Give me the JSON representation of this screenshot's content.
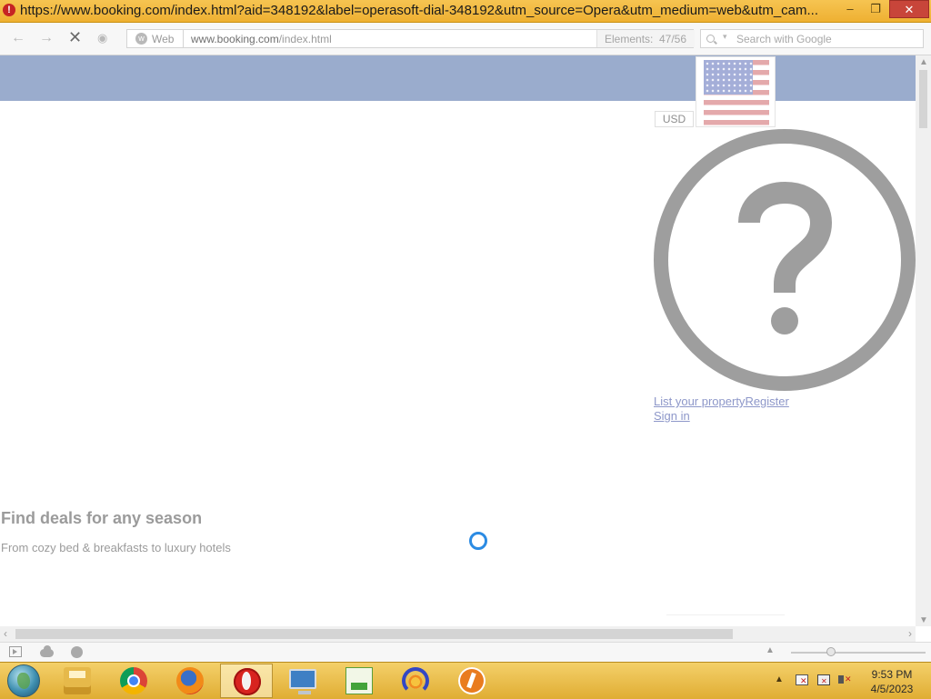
{
  "window": {
    "title": "https://www.booking.com/index.html?aid=348192&label=operasoft-dial-348192&utm_source=Opera&utm_medium=web&utm_cam...",
    "controls": {
      "minimize": "–",
      "maximize": "❐",
      "close": "✕"
    }
  },
  "navbar": {
    "search_type": "Web",
    "url_host": "www.booking.com",
    "url_path": "/index.html",
    "elements_label": "Elements:",
    "elements_count": "47/56",
    "search_placeholder": "Search with Google"
  },
  "page": {
    "currency": "USD",
    "flag_country": "United States",
    "links": {
      "list_property": "List your property",
      "register": "Register",
      "sign_in": "Sign in"
    },
    "deals_title": "Find deals for any season",
    "deals_subtitle": "From cozy bed & breakfasts to luxury hotels"
  },
  "statusbar": {
    "zoom_fraction": 0.3
  },
  "taskbar": {
    "apps": [
      {
        "name": "File Explorer",
        "icon": "file-explorer-icon",
        "active": false
      },
      {
        "name": "Google Chrome",
        "icon": "chrome-icon",
        "active": false
      },
      {
        "name": "Firefox",
        "icon": "firefox-icon",
        "active": false
      },
      {
        "name": "Opera",
        "icon": "opera-icon",
        "active": true
      },
      {
        "name": "Remote Desktop",
        "icon": "monitor-icon",
        "active": false
      },
      {
        "name": "Notepad++",
        "icon": "notepad-icon",
        "active": false
      },
      {
        "name": "Audio Player",
        "icon": "headphones-icon",
        "active": false
      },
      {
        "name": "Pen Tool",
        "icon": "pen-icon",
        "active": false
      }
    ],
    "clock_time": "9:53 PM",
    "clock_date": "4/5/2023"
  },
  "colors": {
    "header_blue": "#9aaccd",
    "link": "#8d97c9",
    "titlebar": "#eeb032",
    "spinner": "#2b8be3"
  }
}
